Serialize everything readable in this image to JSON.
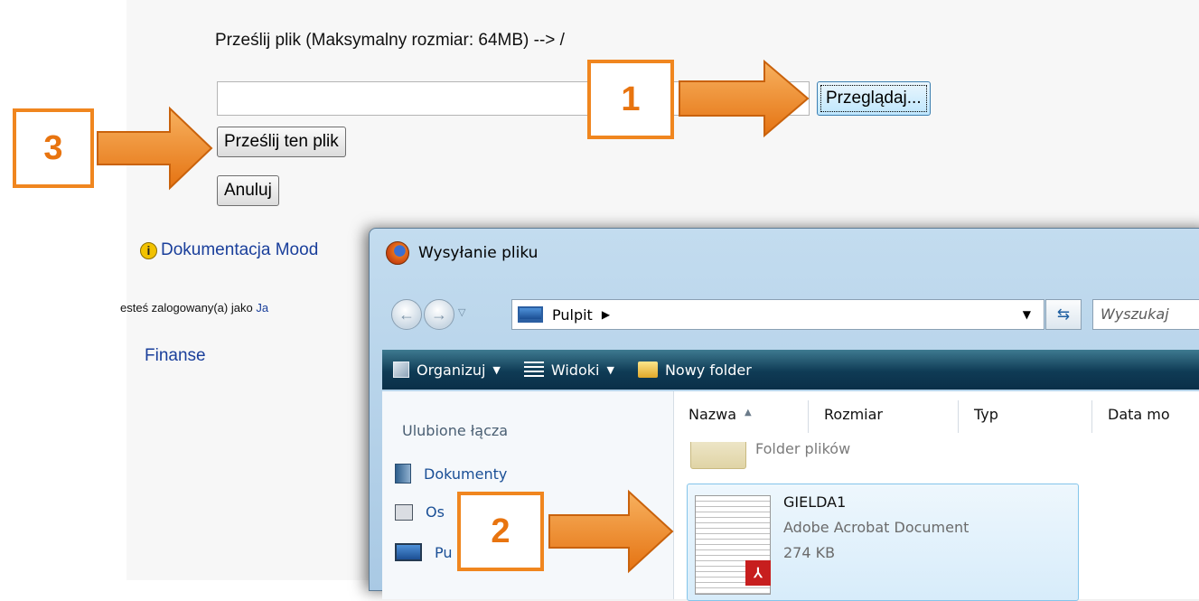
{
  "upload": {
    "title": "Prześlij plik (Maksymalny rozmiar: 64MB) --> /",
    "file_value": "",
    "browse_label": "Przeglądaj...",
    "upload_label": "Prześlij ten plik",
    "cancel_label": "Anuluj"
  },
  "moodle_link": "Dokumentacja Mood",
  "logged_in": {
    "text": "esteś zalogowany(a) jako ",
    "user": "Ja"
  },
  "course_link": "Finanse",
  "dialog": {
    "title": "Wysyłanie pliku",
    "address": "Pulpit",
    "address_arrow": "▶",
    "search_placeholder": "Wyszukaj",
    "toolbar": {
      "organize": "Organizuj",
      "views": "Widoki",
      "new_folder": "Nowy folder"
    },
    "favorites_heading": "Ulubione łącza",
    "favorites": [
      "Dokumenty",
      "Os",
      "Pu"
    ],
    "columns": [
      "Nazwa",
      "Rozmiar",
      "Typ",
      "Data mo"
    ],
    "folder_caption": "Folder plików",
    "file": {
      "name": "GIELDA1",
      "type": "Adobe Acrobat Document",
      "size": "274 KB"
    }
  },
  "callouts": [
    "1",
    "2",
    "3"
  ],
  "colors": {
    "callout_orange": "#f0861f",
    "link_blue": "#1a3f9b",
    "toolbar_dark": "#0f3b55"
  }
}
